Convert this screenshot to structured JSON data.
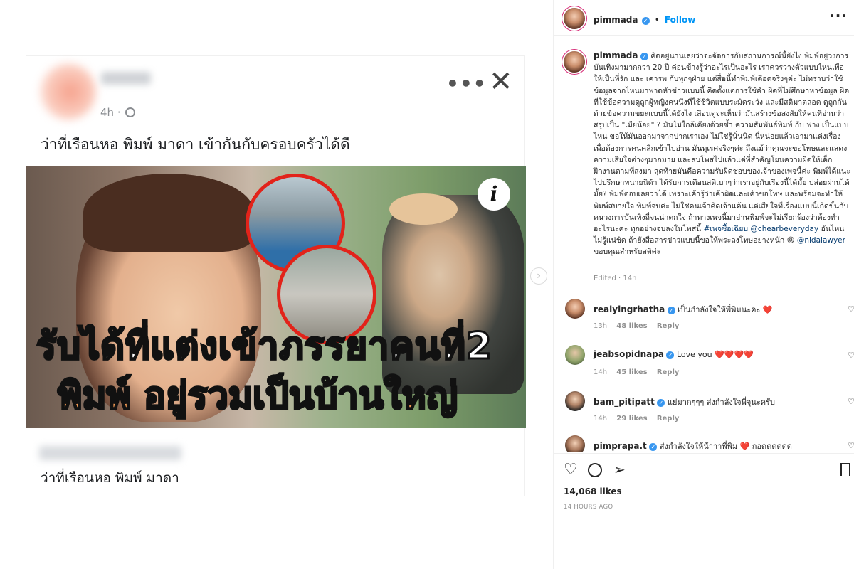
{
  "post": {
    "fb_time": "4h ·",
    "fb_headline": "ว่าที่เรือนหอ พิมพ์ มาดา เข้ากันกับครอบครัวได้ดี",
    "banner_line1": "รับได้ที่แต่งเข้าภรรยาคนที่2",
    "banner_line2": "พิมพ์ อยู่รวมเป็นบ้านใหญ่",
    "info_glyph": "i",
    "fb_footer": "ว่าที่เรือนหอ พิมพ์ มาดา",
    "fb_more": "•••",
    "fb_close": "✕"
  },
  "header": {
    "username": "pimmada",
    "follow_label": "Follow",
    "dot": "•",
    "more": "···"
  },
  "caption": {
    "username": "pimmada",
    "text": " คิดอยู่นานเลยว่าจะจัดการกับสถานการณ์นี้ยังไง พิมพ์อยู่วงการบันเทิงมามากกว่า 20 ปี ค่อนข้างรู้ว่าอะไรเป็นอะไร เราควรวางตัวแบบไหนเพื่อให้เป็นที่รัก และ เคารพ กับทุกๆฝ่าย แต่สื่อนี้ทำพิมพ์เดือดจริงๆค่ะ ไม่ทราบว่าใช้ข้อมูลจากไหนมาพาดหัวข่าวแบบนี้ คิดตั้งแต่การใช้คำ ผิดที่ไม่ศึกษาหาข้อมูล ผิดที่ใช้ข้อความดูถูกผู้หญิงคนนึงที่ใช้ชีวิตแบบระมัดระวัง และมีสติมาตลอด ดูถูกกันด้วยข้อความขยะแบบนี้ได้ยังไง เลื่อนดูจะเห็นว่ามันสร้างข้อสงสัยให้คนที่อ่านว่า สรุปเป็น \"เมียน้อย\" ? มันไม่ใกล้เคียงด้วยซ้ำ ความสัมพันธ์พิมพ์ กับ ฟาง เป็นแบบไหน ขอให้มันออกมาจากปากเราเอง ไม่ใช่รู้นั่นนิด นี่หน่อยแล้วเอามาแต่งเรื่อง เพื่อต้องการคนคลิกเข้าไปอ่าน มันทุเรศจริงๆค่ะ ถึงแม้ว่าคุณจะขอโทษและแสดงความเสียใจต่างๆมากมาย และลบโพสไปแล้วแต่ที่สำคัญโยนความผิดให้เด็กฝึกงานตามที่ส่งมา สุดท้ายมันคือความรับผิดชอบของเจ้าของเพจนี้ค่ะ พิมพ์ได้แนะไปปรึกษาทนายนิด้า ได้รับการเตือนสติเบาๆว่าเราอยู่กับเรื่องนี้ได้มั้ย ปล่อยผ่านได้มั้ย? พิมพ์ตอบเลยว่าได้ เพราะเค้ารู้ว่าเค้าผิดและเค้าขอโทษ และพร้อมจะทำให้พิมพ์สบายใจ พิมพ์จบค่ะ ไม่ใช่คนเจ้าคิดเจ้าแค้น แต่เสียใจที่เรื่องแบบนี้เกิดขึ้นกับคนวงการบันเทิงถี่จนน่าตกใจ ถ้าทางเพจนี้มาอ่านพิมพ์จะไม่เรียกร้องว่าต้องทำอะไรนะคะ ทุกอย่างจบลงในโพสนี้ ",
    "hashtag": "#เพจซื้อเฉียบ",
    "mention1": "@chearbeveryday",
    "text2": " อันไหนไม่รู้แน่ชัด ถ้ายังสื่อสารข่าวแบบนี้ขอให้พระลงโทษอย่างหนัก ",
    "angry": "😡",
    "mention2": "@nidalawyer",
    "text3": " ขอบคุณสำหรับสติค่ะ",
    "edited": "Edited · 14h"
  },
  "comments": [
    {
      "username": "realyingrhatha",
      "text": " เป็นกำลังใจให้พี่พิมนะคะ ",
      "emoji": "❤️",
      "time": "13h",
      "likes": "48 likes",
      "reply": "Reply"
    },
    {
      "username": "jeabsopidnapa",
      "text": " Love you ",
      "emoji": "❤️❤️❤️❤️",
      "time": "14h",
      "likes": "45 likes",
      "reply": "Reply"
    },
    {
      "username": "bam_pitipatt",
      "text": " แย่มากๆๆๆ ส่งกำลังใจพี่จุนะครับ",
      "emoji": "",
      "time": "14h",
      "likes": "29 likes",
      "reply": "Reply"
    },
    {
      "username": "pimprapa.t",
      "text": " ส่งกำลังใจให้น้าาาพี่พิม",
      "emoji": "❤️",
      "text_after": " กอดดดดดด",
      "time": "",
      "likes": "",
      "reply": ""
    }
  ],
  "footer": {
    "likes": "14,068 likes",
    "ago": "14 HOURS AGO"
  },
  "icons": {
    "heart": "heart-icon",
    "comment": "comment-icon",
    "share": "share-icon",
    "bookmark": "bookmark-icon"
  },
  "colors": {
    "link": "#00376b",
    "follow": "#0095f6",
    "verified": "#3897f0",
    "heart": "#ed4956"
  }
}
